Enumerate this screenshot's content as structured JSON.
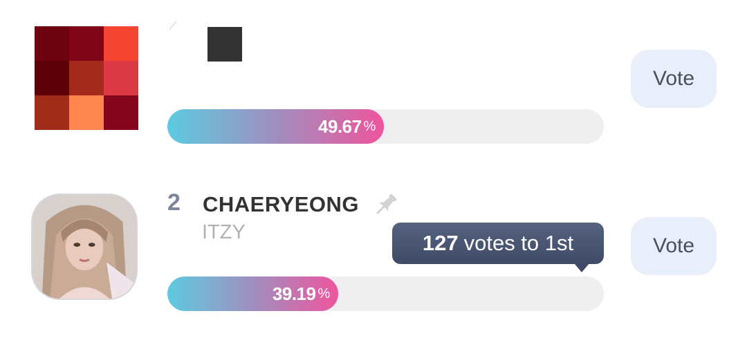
{
  "entries": [
    {
      "percent": "49.67",
      "percent_value": 49.67,
      "percent_sign": "%",
      "vote_label": "Vote",
      "thumbnail_colors": [
        "#6e0410",
        "#7e0616",
        "#f44432",
        "#5c0108",
        "#a32a1c",
        "#dc3a44",
        "#a12c1a",
        "#fc8550",
        "#85051c"
      ]
    },
    {
      "rank": "2",
      "name": "CHAERYEONG",
      "group": "ITZY",
      "votes_to_first": "127",
      "votes_to_first_suffix": "votes to 1st",
      "percent": "39.19",
      "percent_value": 39.19,
      "percent_sign": "%",
      "vote_label": "Vote",
      "pin_icon": "pushpin-icon",
      "avatar": "profile-photo"
    }
  ],
  "colors": {
    "bar_gradient_start": "#5ccbe0",
    "bar_gradient_end": "#ee559d",
    "bar_track": "#efefef",
    "vote_button_bg": "#e8effa",
    "tooltip_bg": "#4a5672"
  }
}
